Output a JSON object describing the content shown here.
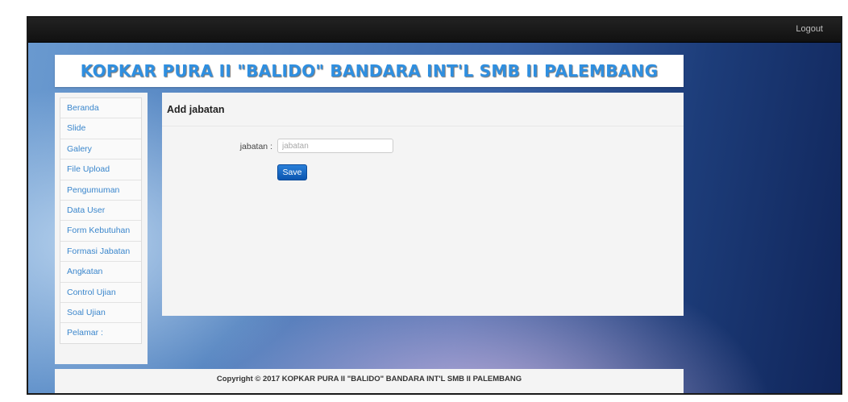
{
  "topbar": {
    "logout_label": "Logout"
  },
  "banner": {
    "title": "KOPKAR PURA II \"BALIDO\" BANDARA INT'L SMB II PALEMBANG"
  },
  "sidebar": {
    "items": [
      {
        "label": "Beranda"
      },
      {
        "label": "Slide"
      },
      {
        "label": "Galery"
      },
      {
        "label": "File Upload"
      },
      {
        "label": "Pengumuman"
      },
      {
        "label": "Data User"
      },
      {
        "label": "Form Kebutuhan"
      },
      {
        "label": "Formasi Jabatan"
      },
      {
        "label": "Angkatan"
      },
      {
        "label": "Control Ujian"
      },
      {
        "label": "Soal Ujian"
      },
      {
        "label": "Pelamar :"
      }
    ]
  },
  "main": {
    "title": "Add jabatan",
    "form": {
      "field_label": "jabatan :",
      "field_value": "",
      "field_placeholder": "jabatan",
      "save_label": "Save"
    }
  },
  "footer": {
    "copyright": "Copyright © 2017 KOPKAR PURA II \"BALIDO\" BANDARA INT'L SMB II PALEMBANG"
  },
  "colors": {
    "banner_title": "#2f8fe0",
    "menu_link": "#3a86cc",
    "save_button": "#0b56b0",
    "topbar": "#111111"
  }
}
